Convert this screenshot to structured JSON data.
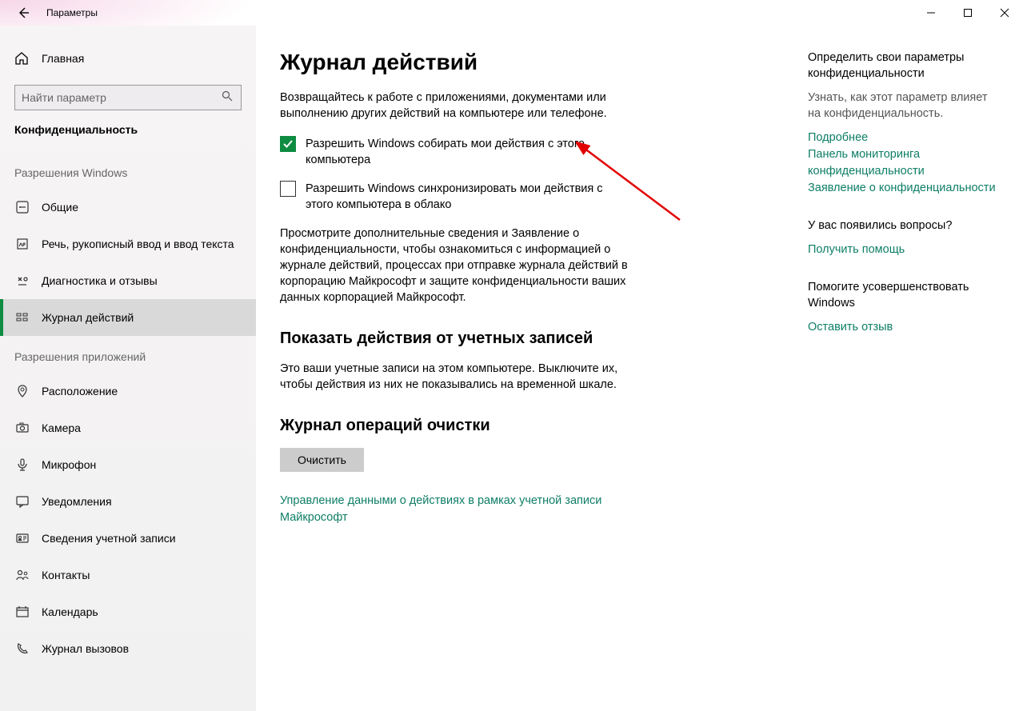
{
  "window": {
    "title": "Параметры"
  },
  "sidebar": {
    "home": "Главная",
    "search_placeholder": "Найти параметр",
    "section": "Конфиденциальность",
    "group_windows": "Разрешения Windows",
    "group_apps": "Разрешения приложений",
    "windows_items": [
      {
        "label": "Общие",
        "name": "sidebar-item-general"
      },
      {
        "label": "Речь, рукописный ввод и ввод текста",
        "name": "sidebar-item-speech"
      },
      {
        "label": "Диагностика и отзывы",
        "name": "sidebar-item-diagnostics"
      },
      {
        "label": "Журнал действий",
        "name": "sidebar-item-activity-history"
      }
    ],
    "app_items": [
      {
        "label": "Расположение",
        "name": "sidebar-item-location"
      },
      {
        "label": "Камера",
        "name": "sidebar-item-camera"
      },
      {
        "label": "Микрофон",
        "name": "sidebar-item-microphone"
      },
      {
        "label": "Уведомления",
        "name": "sidebar-item-notifications"
      },
      {
        "label": "Сведения учетной записи",
        "name": "sidebar-item-account-info"
      },
      {
        "label": "Контакты",
        "name": "sidebar-item-contacts"
      },
      {
        "label": "Календарь",
        "name": "sidebar-item-calendar"
      },
      {
        "label": "Журнал вызовов",
        "name": "sidebar-item-call-history"
      }
    ]
  },
  "main": {
    "heading": "Журнал действий",
    "intro": "Возвращайтесь к работе с приложениями, документами или выполнению других действий на компьютере или телефоне.",
    "check1": "Разрешить Windows собирать мои действия с этого компьютера",
    "check1_checked": true,
    "check2": "Разрешить Windows синхронизировать мои действия с этого компьютера в облако",
    "check2_checked": false,
    "details": "Просмотрите дополнительные сведения и Заявление о конфиденциальности, чтобы ознакомиться с информацией о журнале действий, процессах при отправке журнала действий в корпорацию Майкрософт и защите конфиденциальности ваших данных корпорацией Майкрософт.",
    "accounts_heading": "Показать действия от учетных записей",
    "accounts_text": "Это ваши учетные записи на этом компьютере. Выключите их, чтобы действия из них не показывались на временной шкале.",
    "clear_heading": "Журнал операций очистки",
    "clear_button": "Очистить",
    "manage_link": "Управление данными о действиях в рамках учетной записи Майкрософт"
  },
  "aside": {
    "b1_title": "Определить свои параметры конфиденциальности",
    "b1_text": "Узнать, как этот параметр влияет на конфиденциальность.",
    "link_more": "Подробнее",
    "link_dashboard": "Панель мониторинга конфиденциальности",
    "link_statement": "Заявление о конфиденциальности",
    "b2_title": "У вас появились вопросы?",
    "link_help": "Получить помощь",
    "b3_title": "Помогите усовершенствовать Windows",
    "link_feedback": "Оставить отзыв"
  }
}
